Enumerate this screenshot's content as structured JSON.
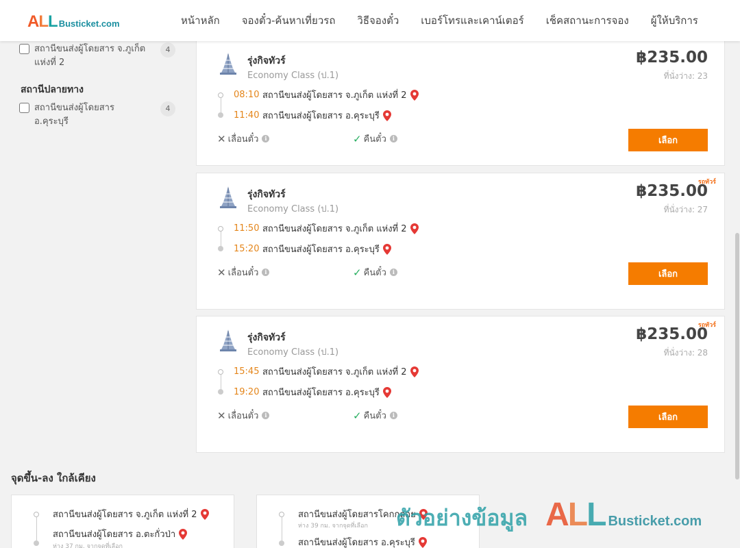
{
  "header": {
    "logo_all": [
      "A",
      "L",
      "L"
    ],
    "logo_rest": "Busticket.com",
    "nav": [
      "หน้าหลัก",
      "จองตั๋ว-ค้นหาเที่ยวรถ",
      "วิธีจองตั๋ว",
      "เบอร์โทรและเคาน์เตอร์",
      "เช็คสถานะการจอง",
      "ผู้ให้บริการ"
    ]
  },
  "sidebar": {
    "origin_filter": {
      "label": "สถานีขนส่งผู้โดยสาร จ.ภูเก็ต แห่งที่ 2",
      "count": "4"
    },
    "destination_heading": "สถานีปลายทาง",
    "destination_filter": {
      "label": "สถานีขนส่งผู้โดยสาร อ.คุระบุรี",
      "count": "4"
    }
  },
  "trips": [
    {
      "operator": "รุ่งกิจทัวร์",
      "class": "Economy Class (ป.1)",
      "price": "฿235.00",
      "seats": "ที่นั่งว่าง: 23",
      "tag": "",
      "depart_time": "08:10",
      "depart_station": "สถานีขนส่งผู้โดยสาร จ.ภูเก็ต แห่งที่ 2",
      "arrive_time": "11:40",
      "arrive_station": "สถานีขนส่งผู้โดยสาร อ.คุระบุรี",
      "reschedule": "เลื่อนตั๋ว",
      "refund": "คืนตั๋ว",
      "select": "เลือก"
    },
    {
      "operator": "รุ่งกิจทัวร์",
      "class": "Economy Class (ป.1)",
      "price": "฿235.00",
      "seats": "ที่นั่งว่าง: 27",
      "tag": "รถทัวร์",
      "depart_time": "11:50",
      "depart_station": "สถานีขนส่งผู้โดยสาร จ.ภูเก็ต แห่งที่ 2",
      "arrive_time": "15:20",
      "arrive_station": "สถานีขนส่งผู้โดยสาร อ.คุระบุรี",
      "reschedule": "เลื่อนตั๋ว",
      "refund": "คืนตั๋ว",
      "select": "เลือก"
    },
    {
      "operator": "รุ่งกิจทัวร์",
      "class": "Economy Class (ป.1)",
      "price": "฿235.00",
      "seats": "ที่นั่งว่าง: 28",
      "tag": "รถทัวร์",
      "depart_time": "15:45",
      "depart_station": "สถานีขนส่งผู้โดยสาร จ.ภูเก็ต แห่งที่ 2",
      "arrive_time": "19:20",
      "arrive_station": "สถานีขนส่งผู้โดยสาร อ.คุระบุรี",
      "reschedule": "เลื่อนตั๋ว",
      "refund": "คืนตั๋ว",
      "select": "เลือก"
    }
  ],
  "nearby": {
    "title": "จุดขึ้น-ลง ใกล้เคียง",
    "cards": [
      {
        "from": "สถานีขนส่งผู้โดยสาร จ.ภูเก็ต แห่งที่ 2",
        "from_note": "",
        "to": "สถานีขนส่งผู้โดยสาร อ.ตะกั่วป่า",
        "to_note": "ห่าง 37 กม. จากจุดที่เลือก"
      },
      {
        "from": "สถานีขนส่งผู้โดยสารโคกกลอย",
        "from_note": "ห่าง 39 กม. จากจุดที่เลือก",
        "to": "สถานีขนส่งผู้โดยสาร อ.คุระบุรี",
        "to_note": ""
      }
    ]
  },
  "watermark": {
    "text": "ตัวอย่างข้อมูล",
    "all": [
      "A",
      "L",
      "L"
    ],
    "rest": "Busticket.com"
  },
  "icons": {
    "pin": "map-pin-icon",
    "cross": "x-icon",
    "check": "check-icon",
    "info": "info-icon",
    "operator_logo": "temple-logo-icon"
  },
  "colors": {
    "accent": "#f57c00",
    "time": "#e4851a",
    "pin": "#e53935",
    "check": "#27ae60"
  }
}
